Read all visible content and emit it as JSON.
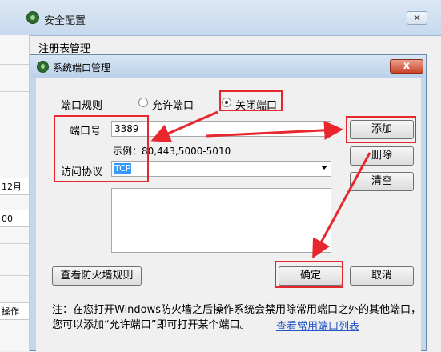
{
  "outer_window": {
    "title": "安全配置",
    "close_label": "×",
    "menu_label": "注册表管理",
    "left_field_1": "12月",
    "left_field_2": "00",
    "left_button": "操作"
  },
  "dialog": {
    "title": "系统端口管理",
    "close_label": "x",
    "port_rule": {
      "label": "端口规则",
      "options": [
        "允许端口",
        "关闭端口"
      ],
      "selected": "关闭端口"
    },
    "port": {
      "label": "端口号",
      "value": "3389",
      "example": "示例：80,443,5000-5010"
    },
    "protocol": {
      "label": "访问协议",
      "value": "TCP"
    },
    "buttons": {
      "add": "添加",
      "delete": "删除",
      "clear": "清空",
      "view_rules": "查看防火墙规则",
      "ok": "确定",
      "cancel": "取消"
    },
    "note_line1": "注：在您打开Windows防火墙之后操作系统会禁用除常用端口之外的其他端口，",
    "note_line2": "您可以添加“允许端口”即可打开某个端口。",
    "link_label": "查看常用端口列表"
  },
  "colors": {
    "annotation_red": "#e8262e",
    "link_blue": "#2457c5",
    "selection_blue": "#3399ff"
  }
}
